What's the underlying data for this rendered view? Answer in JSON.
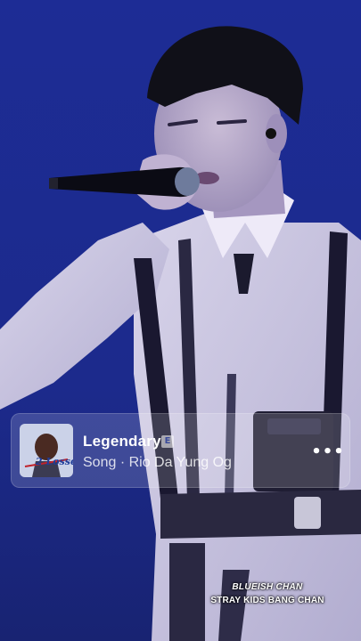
{
  "video": {
    "background_color": "#1b2a8f",
    "subject": "performer-singing-with-microphone"
  },
  "music_card": {
    "title": "Legendary",
    "explicit_badge": "E",
    "subtitle": "Song · Rio Da Yung Og",
    "album_text": "2 Lossed",
    "more_icon": "more-horizontal-icon",
    "more_label": "•••"
  },
  "watermark": {
    "line1": "BLUEISH CHAN",
    "line2": "STRAY KIDS BANG CHAN"
  }
}
